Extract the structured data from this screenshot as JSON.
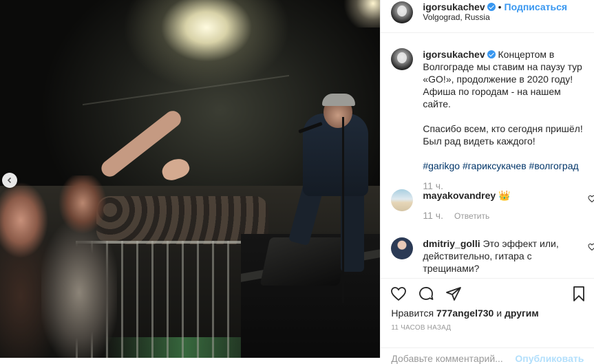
{
  "header": {
    "username": "igorsukachev",
    "separator": "•",
    "follow_label": "Подписаться",
    "location": "Volgograd, Russia"
  },
  "caption": {
    "username": "igorsukachev",
    "text_1": " Концертом в Волгограде мы ставим на паузу тур «GO!», продолжение в 2020 году! Афиша по городам - на нашем сайте.",
    "text_2": "Спасибо всем, кто сегодня пришёл! Был рад видеть каждого!",
    "hashtags": "#garikgo #гариксукачев #волгоград",
    "time": "11 ч."
  },
  "comments": [
    {
      "username": "mayakovandrey",
      "text": " 👑",
      "time": "11 ч.",
      "reply_label": "Ответить"
    },
    {
      "username": "dmitriy_golli",
      "text": " Это эффект или, действительно, гитара с трещинами?"
    }
  ],
  "likes": {
    "prefix": "Нравится ",
    "user": "777angel730",
    "suffix": " и ",
    "others": "другим"
  },
  "post_time": "11 часов назад",
  "add_comment": {
    "placeholder": "Добавьте комментарий...",
    "publish_label": "Опубликовать"
  },
  "colors": {
    "accent": "#3897f0",
    "hashtag": "#003569",
    "muted": "#999999",
    "publish_disabled": "#b2dffc"
  }
}
